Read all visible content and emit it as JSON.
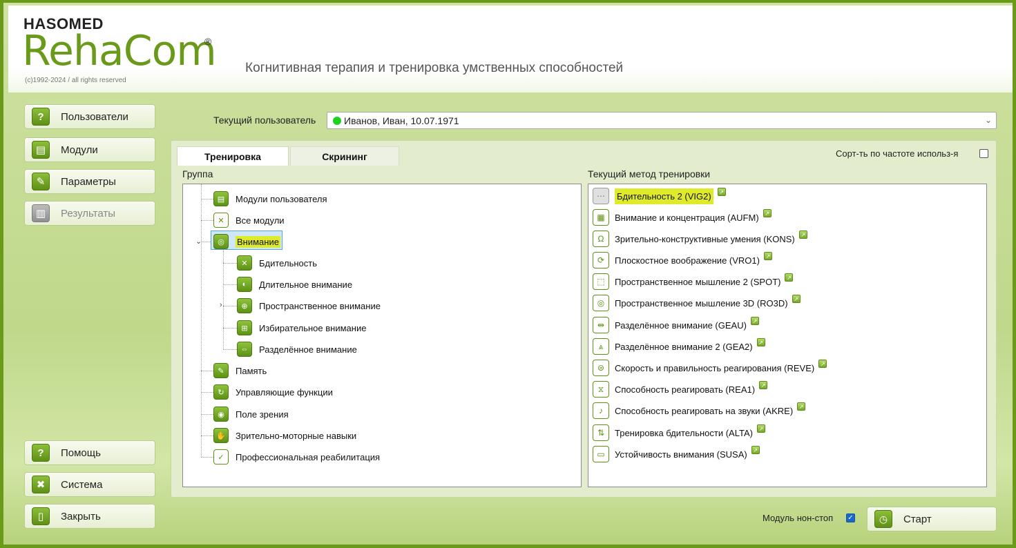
{
  "brand": {
    "company": "HASOMED",
    "product_reha": "Reha",
    "product_com": "Com",
    "registered": "®",
    "copyright": "(c)1992-2024 / all rights reserved",
    "subtitle": "Когнитивная терапия и тренировка умственных способностей"
  },
  "nav": {
    "users": "Пользователи",
    "modules": "Модули",
    "parameters": "Параметры",
    "results": "Результаты",
    "help": "Помощь",
    "system": "Система",
    "close": "Закрыть"
  },
  "current_user": {
    "label": "Текущий пользователь",
    "value": "Иванов, Иван, 10.07.1971",
    "status_color": "#1fd01f"
  },
  "tabs": {
    "training": "Тренировка",
    "screening": "Скрининг"
  },
  "sort": {
    "label": "Сорт-ть по частоте использ-я",
    "checked": false
  },
  "group": {
    "header": "Группа",
    "items": [
      {
        "label": "Модули пользователя",
        "icon": "user-modules-icon"
      },
      {
        "label": "Все модули",
        "icon": "all-modules-icon"
      },
      {
        "label": "Внимание",
        "icon": "attention-icon",
        "selected": true
      },
      {
        "label": "Бдительность",
        "icon": "vigilance-icon"
      },
      {
        "label": "Длительное внимание",
        "icon": "sustained-attention-icon"
      },
      {
        "label": "Пространственное внимание",
        "icon": "spatial-attention-icon"
      },
      {
        "label": "Избирательное внимание",
        "icon": "selective-attention-icon"
      },
      {
        "label": "Разделённое внимание",
        "icon": "divided-attention-icon"
      },
      {
        "label": "Память",
        "icon": "memory-icon"
      },
      {
        "label": "Управляющие функции",
        "icon": "executive-functions-icon"
      },
      {
        "label": "Поле зрения",
        "icon": "visual-field-icon"
      },
      {
        "label": "Зрительно-моторные навыки",
        "icon": "visuomotor-icon"
      },
      {
        "label": "Профессиональная реабилитация",
        "icon": "vocational-rehab-icon"
      }
    ]
  },
  "methods": {
    "header": "Текущий метод тренировки",
    "items": [
      {
        "label": "Бдительность 2 (VIG2)"
      },
      {
        "label": "Внимание и концентрация (AUFM)"
      },
      {
        "label": "Зрительно-конструктивные умения (KONS)"
      },
      {
        "label": "Плоскостное воображение (VRO1)"
      },
      {
        "label": "Пространственное мышление 2 (SPOT)"
      },
      {
        "label": "Пространственное мышление 3D (RO3D)"
      },
      {
        "label": "Разделённое внимание (GEAU)"
      },
      {
        "label": "Разделённое внимание 2 (GEA2)"
      },
      {
        "label": "Скорость и правильность реагирования (REVE)"
      },
      {
        "label": "Способность реагировать (REA1)"
      },
      {
        "label": "Способность реагировать на звуки (AKRE)"
      },
      {
        "label": "Тренировка бдительности (ALTA)"
      },
      {
        "label": "Устойчивость внимания (SUSA)"
      }
    ]
  },
  "bottom": {
    "nonstop_label": "Модуль нон-стоп",
    "nonstop_checked": true,
    "start": "Старт"
  },
  "colors": {
    "brand_green": "#6a9a1a",
    "highlight_yellow": "#dfea2a",
    "selection_blue": "#58a4e0"
  }
}
